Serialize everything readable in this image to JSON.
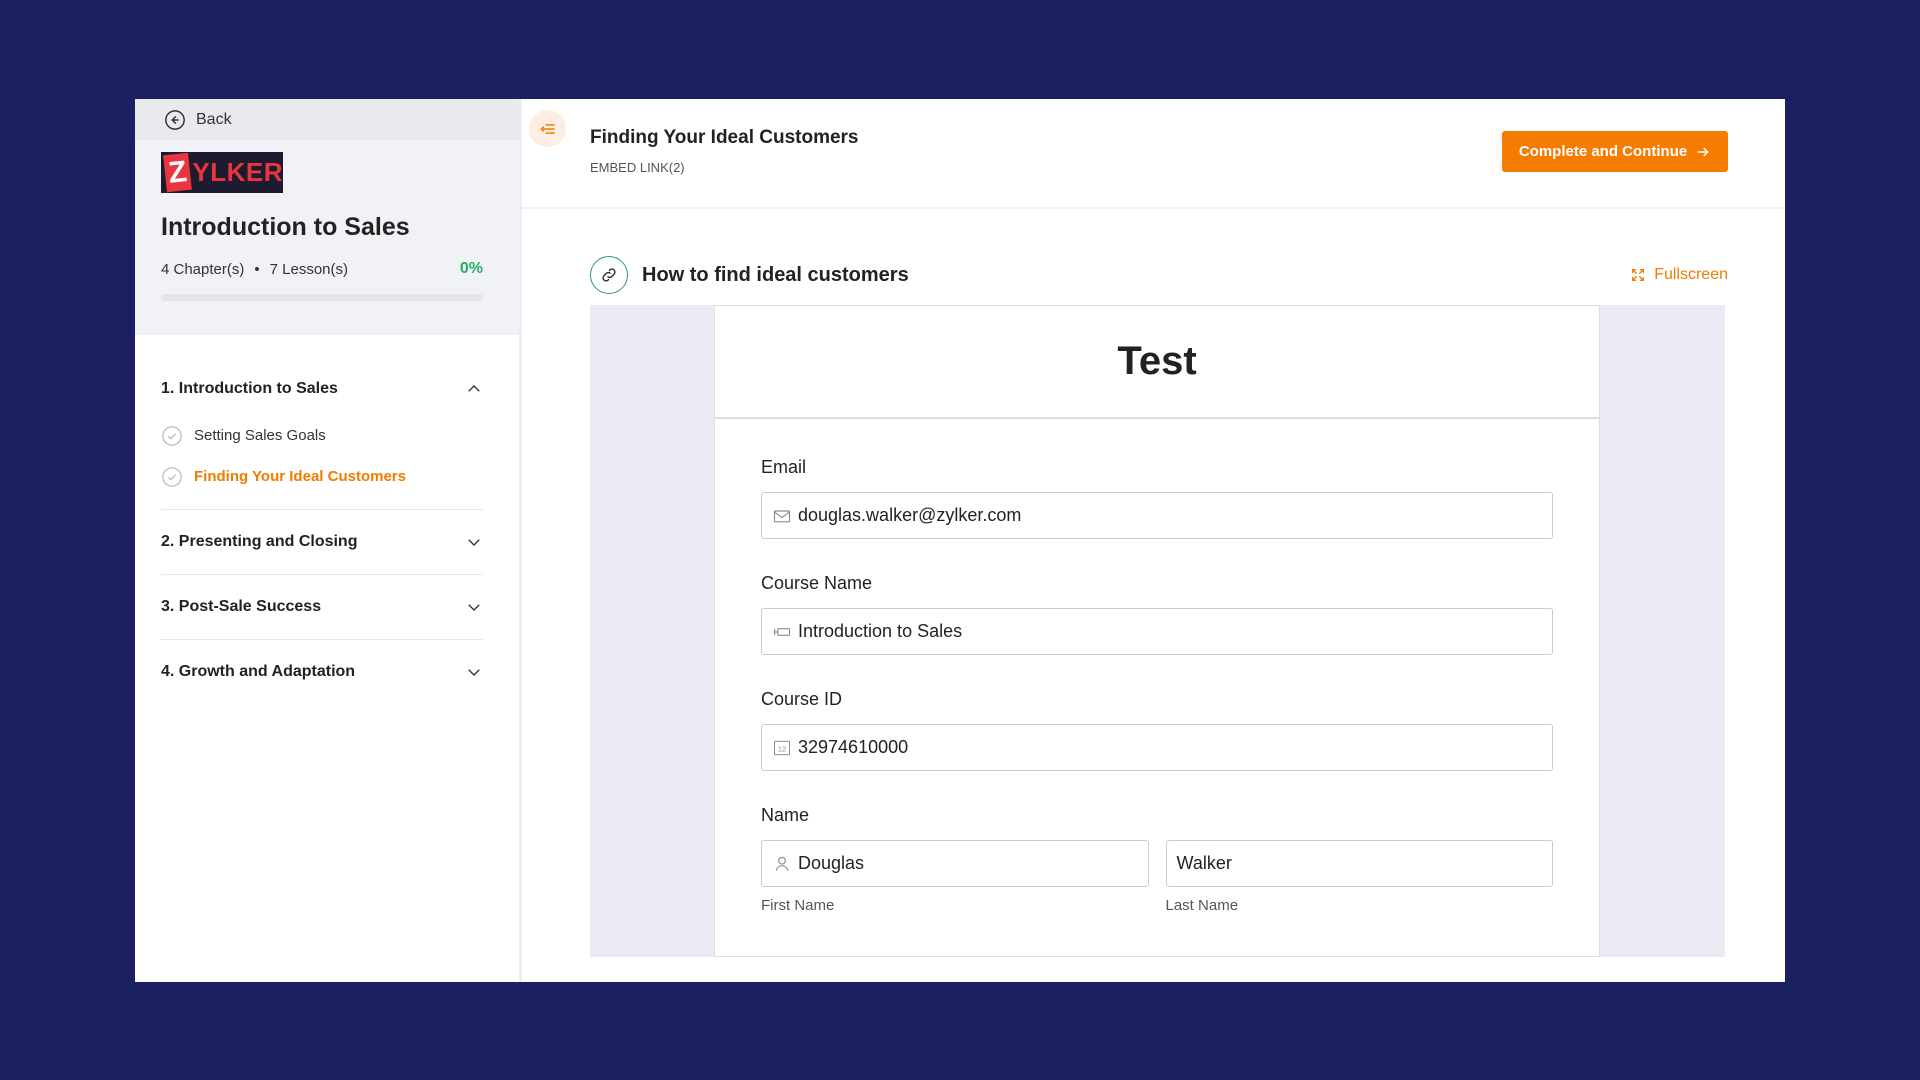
{
  "sidebar": {
    "back_label": "Back",
    "logo": {
      "letter": "Z",
      "rest": "YLKER"
    },
    "course_title": "Introduction to Sales",
    "chapters_count": "4 Chapter(s)",
    "lessons_count": "7 Lesson(s)",
    "separator": "•",
    "progress_label": "0%",
    "progress_value": 0,
    "chapters": [
      {
        "label": "1. Introduction to Sales",
        "expanded": true,
        "lessons": [
          {
            "label": "Setting Sales Goals",
            "active": false
          },
          {
            "label": "Finding Your Ideal Customers",
            "active": true
          }
        ]
      },
      {
        "label": "2. Presenting and Closing",
        "expanded": false
      },
      {
        "label": "3. Post-Sale Success",
        "expanded": false
      },
      {
        "label": "4. Growth and Adaptation",
        "expanded": false
      }
    ]
  },
  "header": {
    "lesson_title": "Finding Your Ideal Customers",
    "lesson_subtitle": "EMBED LINK(2)",
    "complete_button": "Complete and Continue"
  },
  "embed": {
    "title": "How to find ideal customers",
    "fullscreen_label": "Fullscreen"
  },
  "form": {
    "title": "Test",
    "email": {
      "label": "Email",
      "value": "douglas.walker@zylker.com"
    },
    "course_name": {
      "label": "Course Name",
      "value": "Introduction to Sales"
    },
    "course_id": {
      "label": "Course ID",
      "value": "32974610000"
    },
    "name": {
      "label": "Name",
      "first_value": "Douglas",
      "last_value": "Walker",
      "first_sublabel": "First Name",
      "last_sublabel": "Last Name"
    }
  },
  "colors": {
    "background": "#1b2063",
    "accent": "#f57c00",
    "progress": "#27ae60",
    "brand": "#e8353f"
  }
}
